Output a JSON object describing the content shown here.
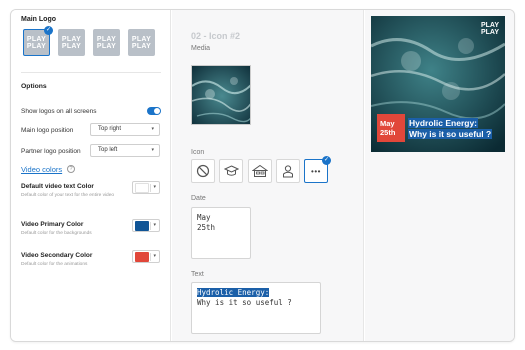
{
  "left_panel": {
    "main_logo_title": "Main Logo",
    "logos": [
      {
        "text": "PLAY\nPLAY",
        "selected": true
      },
      {
        "text": "PLAY\nPLAY",
        "selected": false
      },
      {
        "text": "PLAY\nPLAY",
        "selected": false
      },
      {
        "text": "PLAY\nPLAY",
        "selected": false
      }
    ],
    "options_title": "Options",
    "show_logos_label": "Show logos on all screens",
    "show_logos_on": true,
    "main_logo_position_label": "Main logo position",
    "main_logo_position_value": "Top right",
    "partner_logo_position_label": "Partner logo position",
    "partner_logo_position_value": "Top left",
    "video_colors_link": "Video colors",
    "help_glyph": "?",
    "colors": [
      {
        "label": "Default video text Color",
        "desc": "Default color of your text for the entire video",
        "hex": "#ffffff"
      },
      {
        "label": "Video Primary Color",
        "desc": "Default color for the backgrounds",
        "hex": "#0f5496"
      },
      {
        "label": "Video Secondary Color",
        "desc": "Default color for the animations",
        "hex": "#e1473a"
      }
    ]
  },
  "middle_panel": {
    "title": "02 - Icon #2",
    "media_label": "Media",
    "icon_label": "Icon",
    "icons": [
      "block-icon",
      "graduation-cap-icon",
      "house-icon",
      "user-icon",
      "more-icon"
    ],
    "selected_icon_index": 4,
    "date_label": "Date",
    "date_value": "May\n25th",
    "text_label": "Text",
    "text_line1": "Hydrolic Energy:",
    "text_line2": "Why is it so useful ?"
  },
  "preview": {
    "logo_text": "PLAY\nPLAY",
    "date_line1": "May",
    "date_line2": "25th",
    "title_line1": "Hydrolic Energy:",
    "title_line2": "Why is it so useful ?"
  },
  "colors": {
    "accent": "#1b74c9",
    "highlight": "#1b5fa8",
    "red": "#e1473a"
  }
}
